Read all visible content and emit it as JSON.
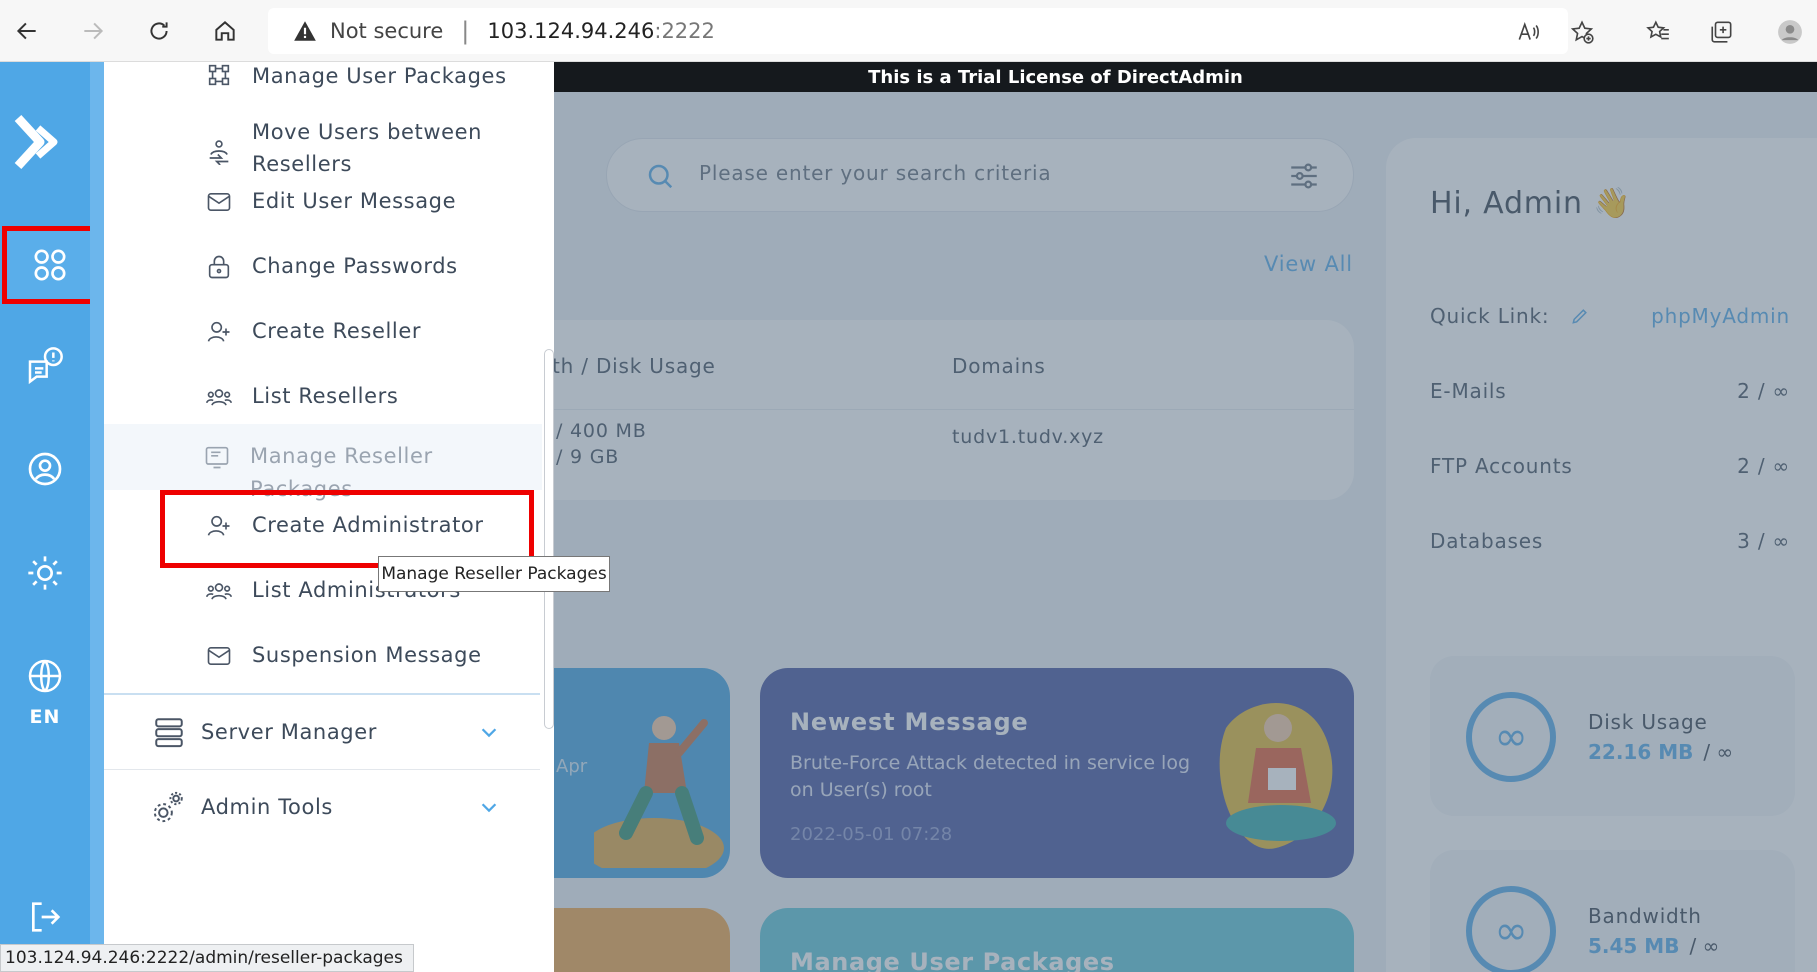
{
  "browser": {
    "not_secure": "Not secure",
    "host": "103.124.94.246",
    "port": ":2222",
    "icons": [
      "back-icon",
      "forward-icon",
      "refresh-icon",
      "home-icon",
      "warning-icon",
      "read-aloud-icon",
      "add-favorite-icon",
      "favorites-icon",
      "collections-icon",
      "profile-icon"
    ]
  },
  "banner": "This is a Trial License of DirectAdmin",
  "rail": {
    "lang": "EN",
    "items": [
      "logo",
      "apps-grid",
      "messages",
      "account",
      "settings",
      "language",
      "logout"
    ]
  },
  "menu": {
    "items": [
      {
        "label": "Manage User Packages",
        "icon": "packages-icon"
      },
      {
        "label": "Move Users between Resellers",
        "icon": "move-users-icon"
      },
      {
        "label": "Edit User Message",
        "icon": "mail-icon"
      },
      {
        "label": "Change Passwords",
        "icon": "lock-icon"
      },
      {
        "label": "Create Reseller",
        "icon": "add-user-icon"
      },
      {
        "label": "List Resellers",
        "icon": "users-icon"
      },
      {
        "label": "Manage Reseller Packages",
        "icon": "package-icon"
      },
      {
        "label": "Create Administrator",
        "icon": "add-user-icon"
      },
      {
        "label": "List Administrators",
        "icon": "users-icon"
      },
      {
        "label": "Suspension Message",
        "icon": "mail-icon"
      }
    ],
    "sections": [
      {
        "label": "Server Manager",
        "icon": "server-icon"
      },
      {
        "label": "Admin Tools",
        "icon": "gears-icon"
      }
    ],
    "move_users_line1": "Move Users between",
    "move_users_line2": "Resellers"
  },
  "tooltip": "Manage Reseller Packages",
  "search": {
    "placeholder": "Please enter your search criteria"
  },
  "view_all": "View All",
  "table": {
    "col1": "th / Disk Usage",
    "col2": "Domains",
    "usage_line1": "/   400 MB",
    "usage_line2": "/   9 GB",
    "domain": "tudv1.tudv.xyz"
  },
  "cards": {
    "left_label": "Apr",
    "newest_title": "Newest Message",
    "newest_body": "Brute-Force Attack detected in service log on User(s) root",
    "newest_date": "2022-05-01 07:28",
    "bottom_title": "Manage User Packages"
  },
  "right": {
    "greeting": "Hi, Admin 👋",
    "quick_link_label": "Quick Link:",
    "quick_link_value": "phpMyAdmin",
    "rows": [
      {
        "label": "E-Mails",
        "value": "2 / ∞"
      },
      {
        "label": "FTP Accounts",
        "value": "2 / ∞"
      },
      {
        "label": "Databases",
        "value": "3 / ∞"
      }
    ],
    "disk_label": "Disk Usage",
    "disk_value": "22.16 MB",
    "bandwidth_label": "Bandwidth",
    "bandwidth_value": "5.45 MB",
    "infinity": "∞",
    "slash_inf": "/  ∞"
  },
  "status_url": "103.124.94.246:2222/admin/reseller-packages",
  "colors": {
    "accent": "#4fa7e6",
    "highlight": "#e00000",
    "message_card": "#3f4f9b"
  }
}
